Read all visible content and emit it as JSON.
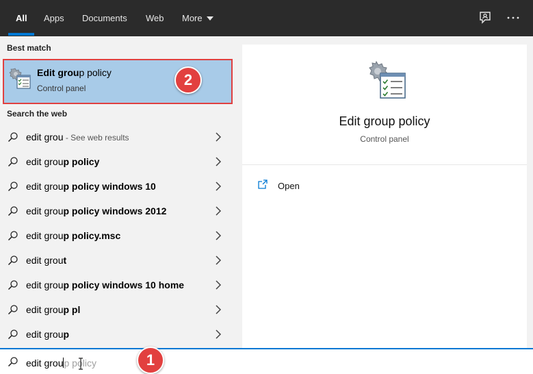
{
  "tabs": [
    {
      "label": "All",
      "active": true
    },
    {
      "label": "Apps",
      "active": false
    },
    {
      "label": "Documents",
      "active": false
    },
    {
      "label": "Web",
      "active": false
    },
    {
      "label": "More",
      "active": false
    }
  ],
  "top_icons": [
    "feedback-icon",
    "more-options-icon"
  ],
  "best_match": {
    "section_label": "Best match",
    "title_typed": "Edit grou",
    "title_rest": "p policy",
    "subtitle": "Control panel",
    "annotation": "2"
  },
  "search_web": {
    "section_label": "Search the web",
    "items": [
      {
        "prefix": "edit grou",
        "suffix": "",
        "hint": " - See web results"
      },
      {
        "prefix": "edit grou",
        "suffix": "p policy",
        "hint": ""
      },
      {
        "prefix": "edit grou",
        "suffix": "p policy windows 10",
        "hint": ""
      },
      {
        "prefix": "edit grou",
        "suffix": "p policy windows 2012",
        "hint": ""
      },
      {
        "prefix": "edit grou",
        "suffix": "p policy.msc",
        "hint": ""
      },
      {
        "prefix": "edit grou",
        "suffix": "t",
        "hint": ""
      },
      {
        "prefix": "edit grou",
        "suffix": "p policy windows 10 home",
        "hint": ""
      },
      {
        "prefix": "edit grou",
        "suffix": "p pl",
        "hint": ""
      },
      {
        "prefix": "edit grou",
        "suffix": "p",
        "hint": ""
      }
    ]
  },
  "preview": {
    "title": "Edit group policy",
    "subtitle": "Control panel",
    "actions": [
      {
        "label": "Open",
        "icon": "open-icon"
      }
    ]
  },
  "search_box": {
    "typed": "edit grou",
    "suggestion": "p policy",
    "annotation": "1"
  },
  "colors": {
    "accent": "#0078d4",
    "selection": "#a8cbe8",
    "annotation_red": "#e2403f",
    "topbar": "#2b2b2b"
  }
}
